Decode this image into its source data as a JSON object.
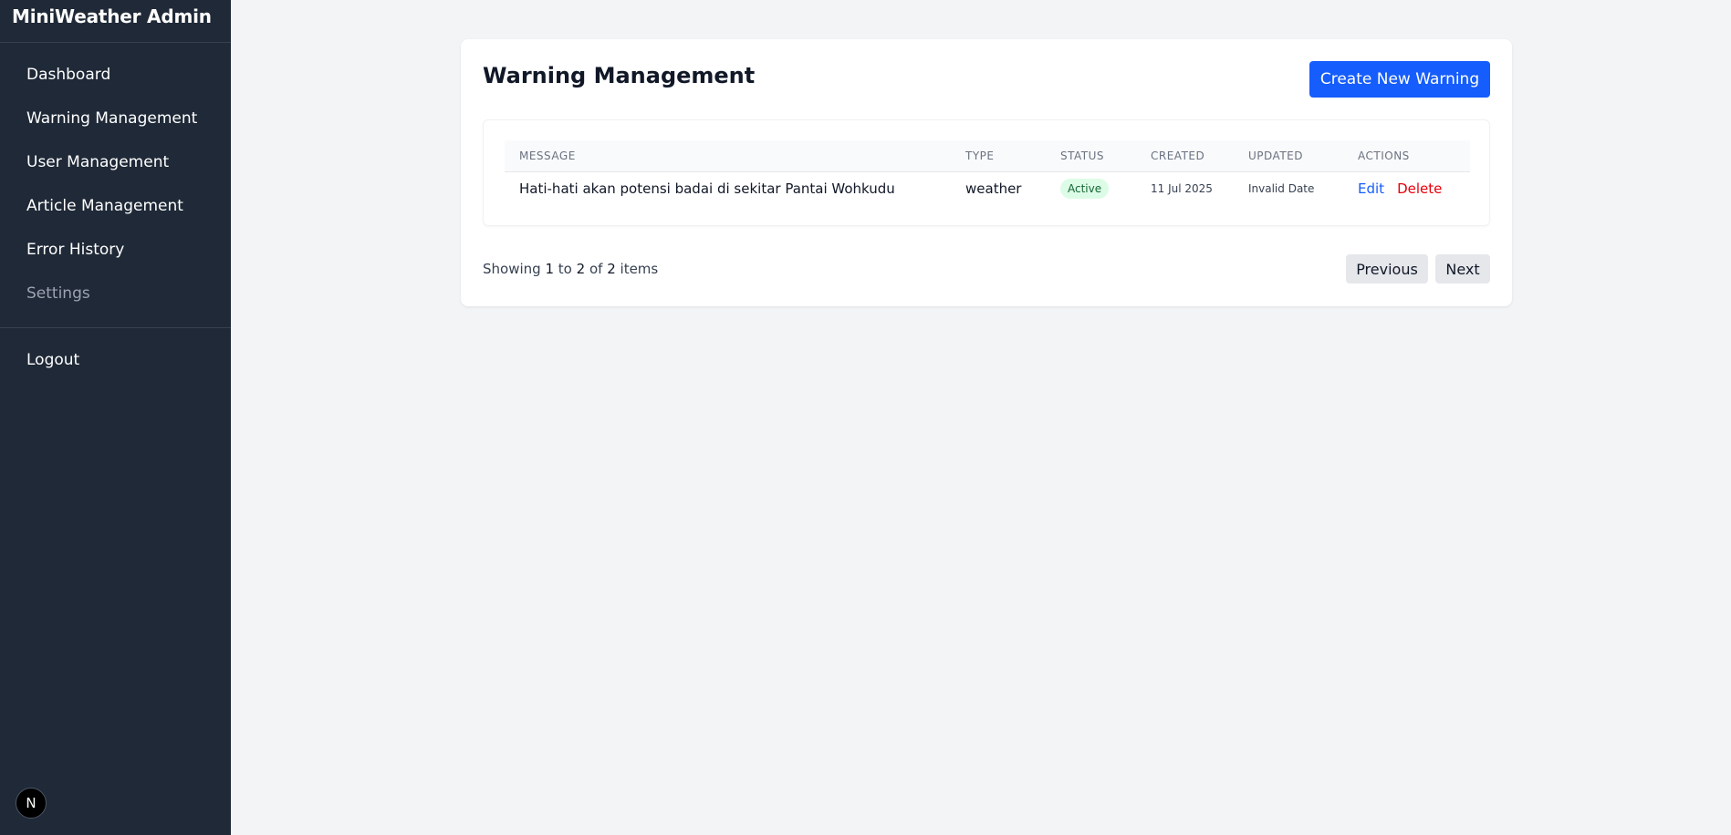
{
  "sidebar": {
    "brand": "MiniWeather Admin",
    "items": [
      {
        "label": "Dashboard"
      },
      {
        "label": "Warning Management"
      },
      {
        "label": "User Management"
      },
      {
        "label": "Article Management"
      },
      {
        "label": "Error History"
      },
      {
        "label": "Settings"
      }
    ],
    "logout": "Logout",
    "avatar_letter": "N"
  },
  "main": {
    "title": "Warning Management",
    "create_button": "Create New Warning",
    "table": {
      "columns": [
        "MESSAGE",
        "TYPE",
        "STATUS",
        "CREATED",
        "UPDATED",
        "ACTIONS"
      ],
      "rows": [
        {
          "message": "Hati-hati akan potensi badai di sekitar Pantai Wohkudu",
          "type": "weather",
          "status": "Active",
          "created": "11 Jul 2025",
          "updated": "Invalid Date",
          "edit": "Edit",
          "delete": "Delete"
        }
      ]
    },
    "pagination": {
      "prefix": "Showing",
      "from": "1",
      "to_word": "to",
      "to": "2",
      "of_word": "of",
      "total": "2",
      "suffix": "items",
      "previous": "Previous",
      "next": "Next"
    }
  },
  "colors": {
    "sidebar_bg": "#1f2937",
    "primary": "#155dfc",
    "danger": "#e7000b",
    "active_badge_bg": "#dcfce7",
    "active_badge_text": "#166534"
  }
}
